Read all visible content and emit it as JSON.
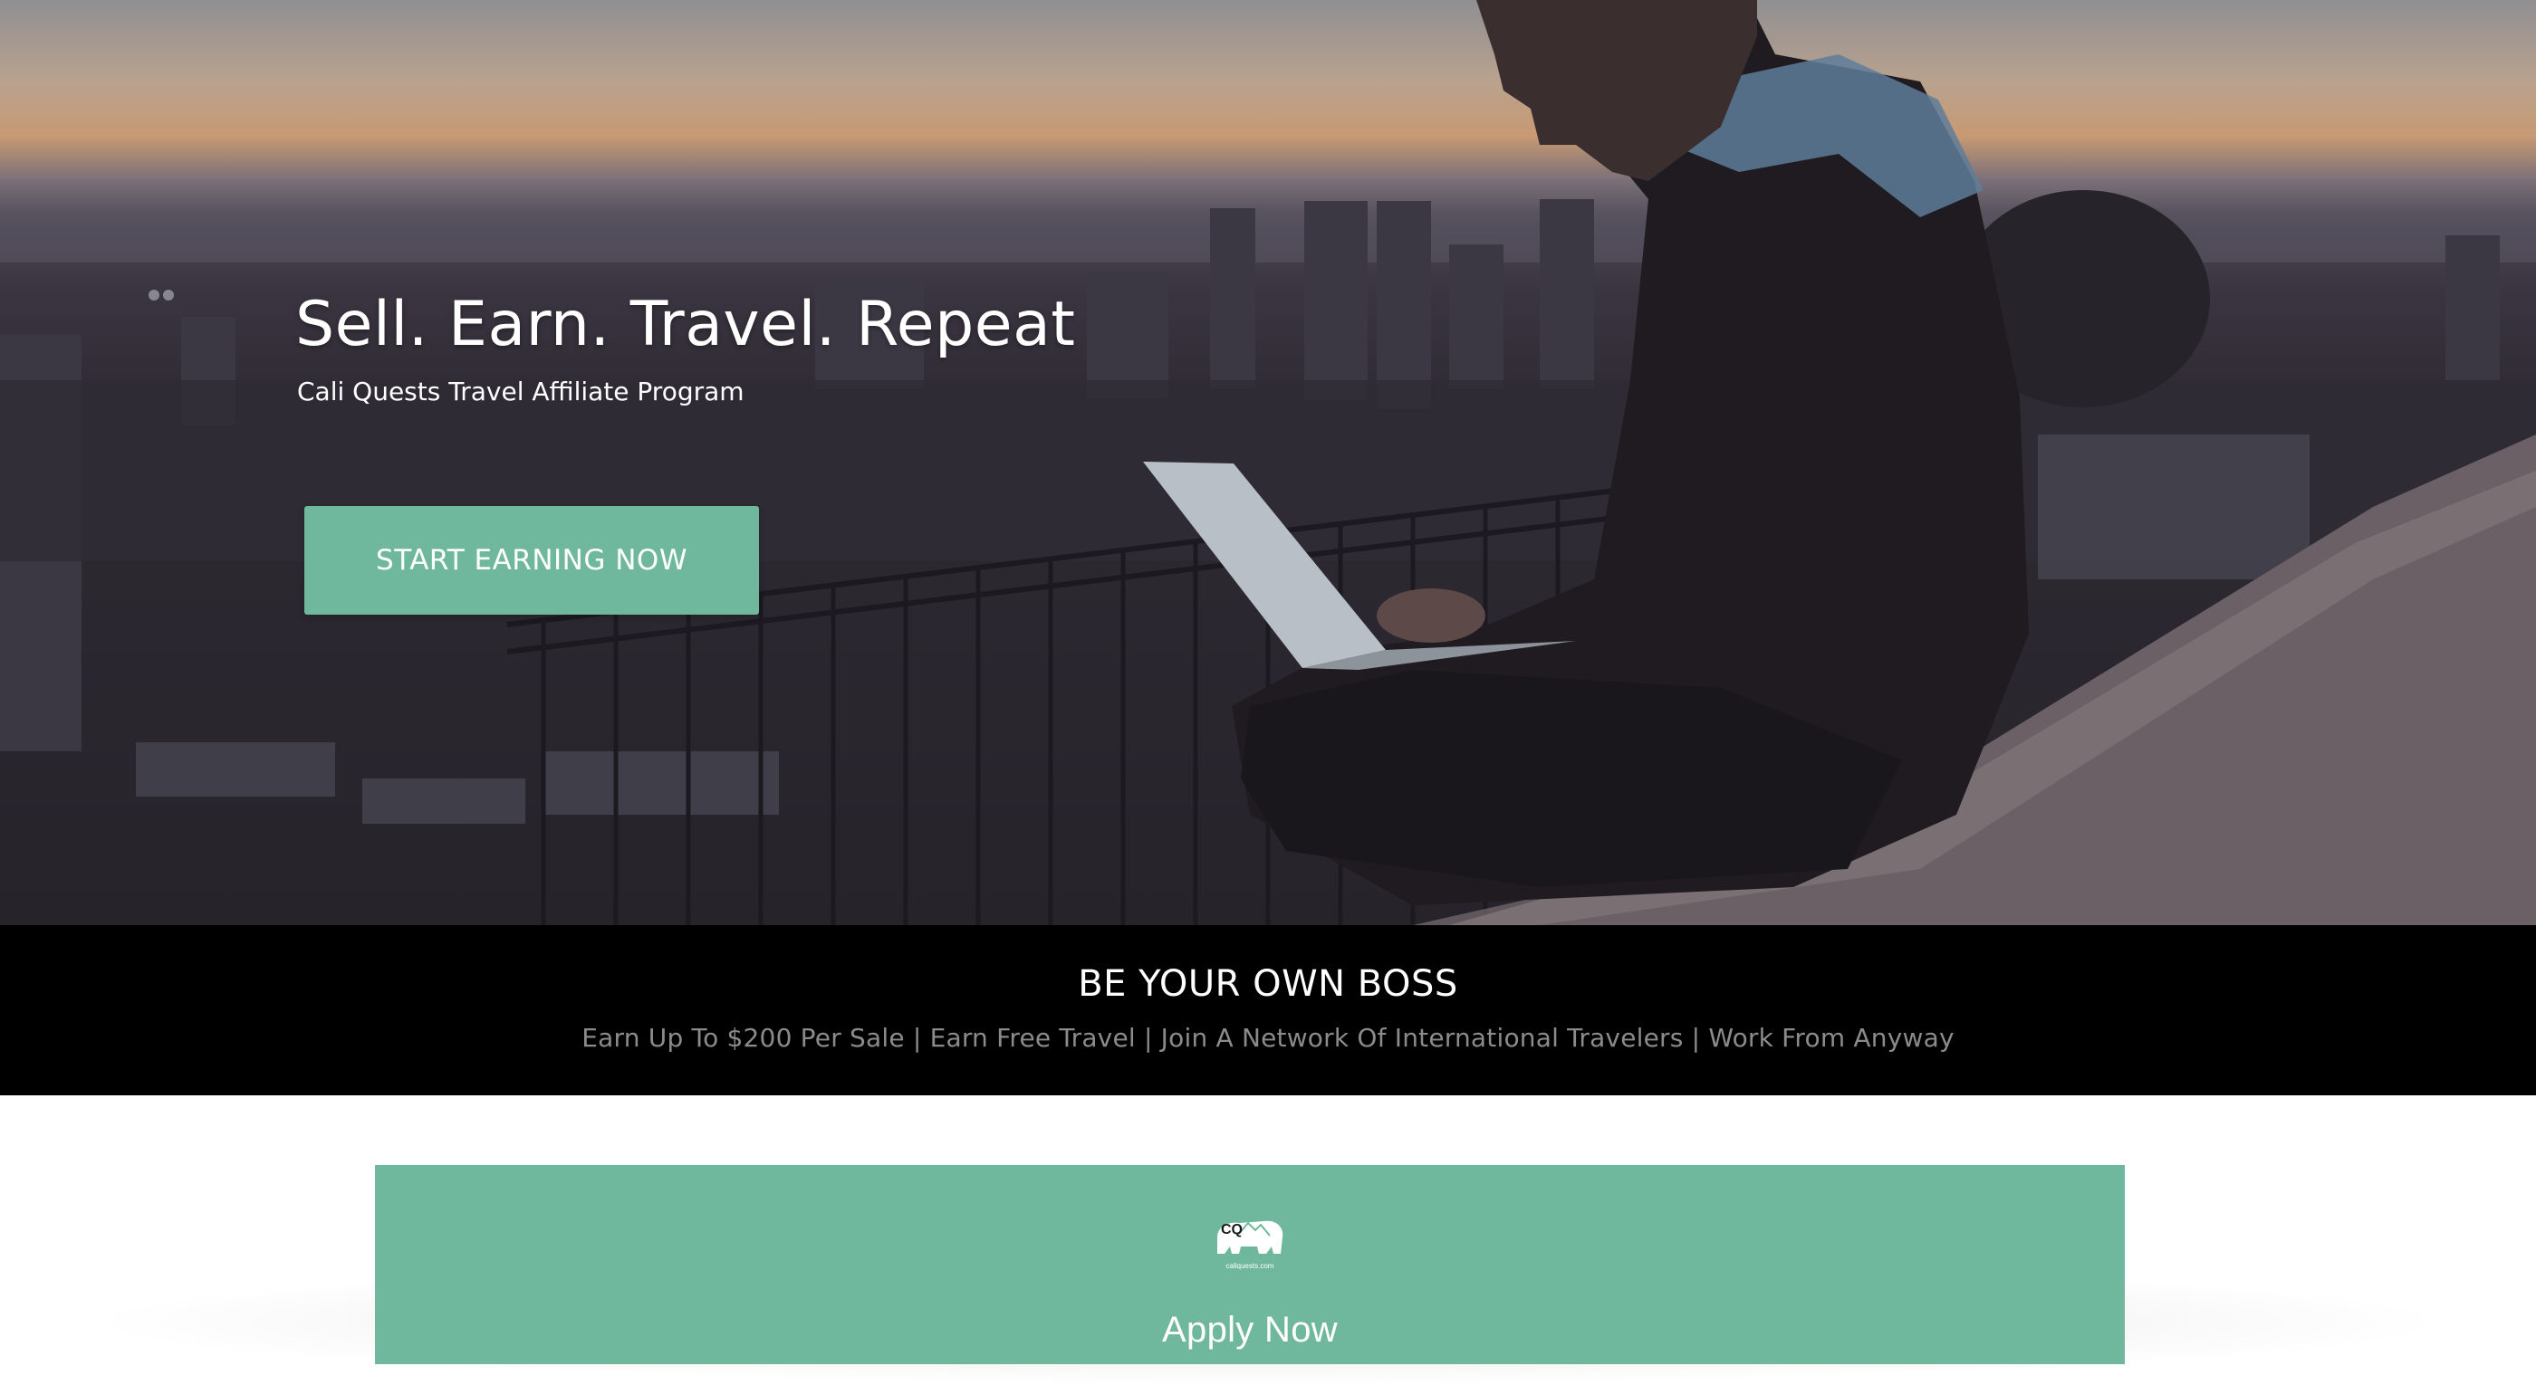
{
  "hero": {
    "title": "Sell. Earn. Travel. Repeat",
    "subtitle": "Cali Quests Travel Affiliate Program",
    "cta_label": "START EARNING NOW"
  },
  "boss_band": {
    "title": "BE YOUR OWN BOSS",
    "subtitle": "Earn Up To $200 Per Sale | Earn Free Travel | Join A Network Of International Travelers | Work From Anyway"
  },
  "apply": {
    "logo_text": "CQ",
    "logo_caption": "caliquests.com",
    "title": "Apply Now"
  },
  "colors": {
    "accent": "#6fb89d",
    "band": "#000000",
    "band_subtext": "#8b8b8b"
  }
}
